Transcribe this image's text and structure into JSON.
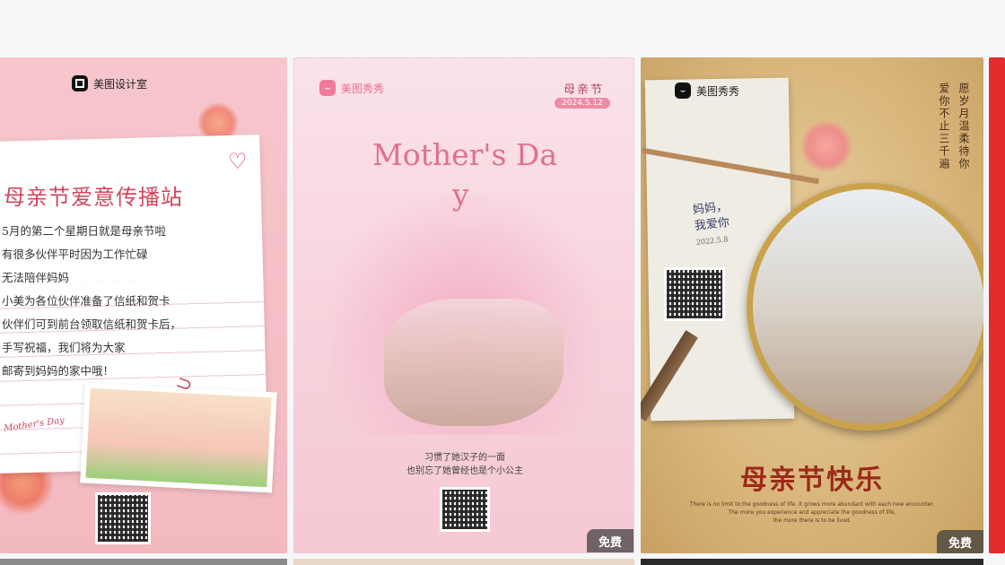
{
  "cards": [
    {
      "brand": "美图设计室",
      "title": "母亲节爱意传播站",
      "lines": [
        "5月的第二个星期日就是母亲节啦",
        "有很多伙伴平时因为工作忙碌",
        "无法陪伴妈妈",
        "小美为各位伙伴准备了信纸和贺卡",
        "伙伴们可到前台领取信纸和贺卡后，",
        "手写祝福，我们将为大家",
        "邮寄到妈妈的家中哦！"
      ],
      "signature": "Mother's Day",
      "colors": {
        "title": "#d2465d",
        "background": "#f6c6cc"
      }
    },
    {
      "brand": "美图秀秀",
      "festival": "母亲节",
      "date": "2024.5.12",
      "title_line1": "Mother's Da",
      "title_line2": "y",
      "caption_line1": "习惯了她汉子的一面",
      "caption_line2": "也别忘了她曾经也是个小公主",
      "badge": "免费",
      "colors": {
        "title": "#e0708f",
        "background": "#fbe3ea"
      }
    },
    {
      "brand": "美图秀秀",
      "vertical_text_1": "愿岁月温柔待你",
      "vertical_text_2": "爱你不止三千遍",
      "handwriting_line1": "妈妈，",
      "handwriting_line2": "我爱你",
      "handwriting_date": "2022.5.8",
      "title": "母亲节快乐",
      "quote_line1": "There is no limit to the goodness of life. It grows more abundant with each new encounter.",
      "quote_line2": "The more you experience and appreciate the goodness of life,",
      "quote_line3": "the more there is to be lived.",
      "badge": "免费",
      "colors": {
        "title": "#9b2a1a",
        "frame": "#c9a24b"
      }
    }
  ]
}
